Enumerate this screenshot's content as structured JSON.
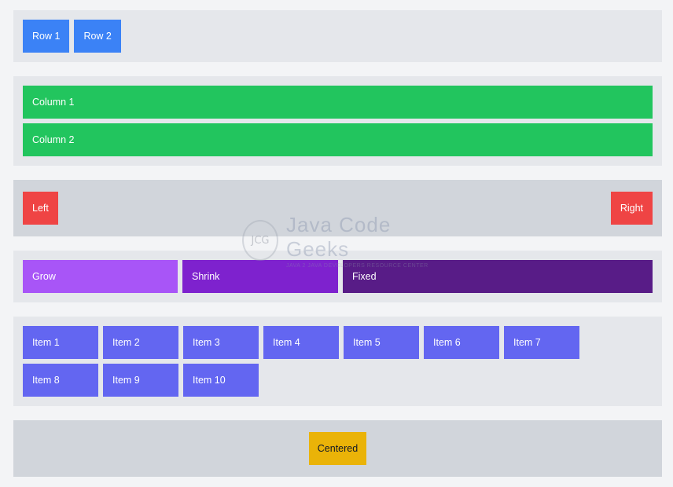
{
  "row_panel": {
    "items": [
      "Row 1",
      "Row 2"
    ]
  },
  "column_panel": {
    "items": [
      "Column 1",
      "Column 2"
    ]
  },
  "space_between_panel": {
    "left_label": "Left",
    "right_label": "Right"
  },
  "grow_panel": {
    "grow_label": "Grow",
    "shrink_label": "Shrink",
    "fixed_label": "Fixed"
  },
  "wrap_panel": {
    "items": [
      "Item 1",
      "Item 2",
      "Item 3",
      "Item 4",
      "Item 5",
      "Item 6",
      "Item 7",
      "Item 8",
      "Item 9",
      "Item 10"
    ]
  },
  "center_panel": {
    "label": "Centered"
  },
  "watermark": {
    "logo_text": "JCG",
    "title": "Java Code Geeks",
    "subtitle": "JAVA 2 JAVA DEVELOPERS RESOURCE CENTER"
  },
  "colors": {
    "row": "#3b82f6",
    "column": "#22c55e",
    "space_between": "#ef4444",
    "grow": "#a855f7",
    "shrink": "#7e22ce",
    "fixed": "#581c87",
    "wrap": "#6366f1",
    "center": "#eab308"
  }
}
